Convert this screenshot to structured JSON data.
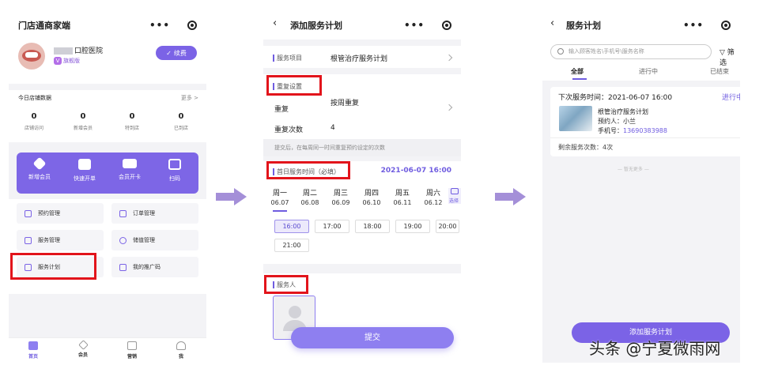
{
  "screen1": {
    "title": "门店通商家端",
    "store_name": "口腔医院",
    "badge": "旗舰版",
    "renew_label": "续费",
    "stats_title": "今日店铺数据",
    "stats_more": "更多 >",
    "stats": [
      {
        "value": "0",
        "label": "店铺访问"
      },
      {
        "value": "0",
        "label": "新增会员"
      },
      {
        "value": "0",
        "label": "特到店"
      },
      {
        "value": "0",
        "label": "已到店"
      }
    ],
    "quick_actions": [
      "新增会员",
      "快速开单",
      "会员开卡",
      "扫码"
    ],
    "menu": [
      "预约管理",
      "订单管理",
      "服务管理",
      "储值管理",
      "服务计划",
      "我的推广码"
    ],
    "tabs": [
      "首页",
      "会员",
      "营销",
      "我"
    ]
  },
  "screen2": {
    "title": "添加服务计划",
    "service_item_label": "服务项目",
    "service_item_value": "根管治疗服务计划",
    "repeat_section": "重复设置",
    "repeat_label": "重复",
    "repeat_value": "按周重复",
    "repeat_count_label": "重复次数",
    "repeat_count_value": "4",
    "hint": "提交后，在每周同一时间重复预约设定的次数",
    "first_time_label": "首日服务时间（必填）",
    "first_time_value": "2021-06-07 16:00",
    "days": [
      {
        "name": "周一",
        "date": "06.07"
      },
      {
        "name": "周二",
        "date": "06.08"
      },
      {
        "name": "周三",
        "date": "06.09"
      },
      {
        "name": "周四",
        "date": "06.10"
      },
      {
        "name": "周五",
        "date": "06.11"
      },
      {
        "name": "周六",
        "date": "06.12"
      }
    ],
    "choose_label": "选择",
    "times": [
      "16:00",
      "17:00",
      "18:00",
      "19:00",
      "20:00",
      "21:00"
    ],
    "staff_label": "服务人",
    "submit_label": "提交"
  },
  "screen3": {
    "title": "服务计划",
    "search_placeholder": "输入顾客姓名\\手机号\\服务名称",
    "filter_label": "筛选",
    "tabs": [
      "全部",
      "进行中",
      "已结束"
    ],
    "card": {
      "next_time": "下次服务时间：2021-06-07 16:00",
      "status": "进行中",
      "plan_name": "根管治疗服务计划",
      "booker": "预约人：小兰",
      "phone_label": "手机号：",
      "phone_value": "13690383988",
      "remaining": "剩余服务次数：4次"
    },
    "no_more": "— 暂无更多 —",
    "add_button": "添加服务计划"
  },
  "watermark": "头条 @宁夏微雨网",
  "colors": {
    "accent": "#7b63e6",
    "highlight": "#e2141b",
    "arrow": "#a48fd8"
  }
}
